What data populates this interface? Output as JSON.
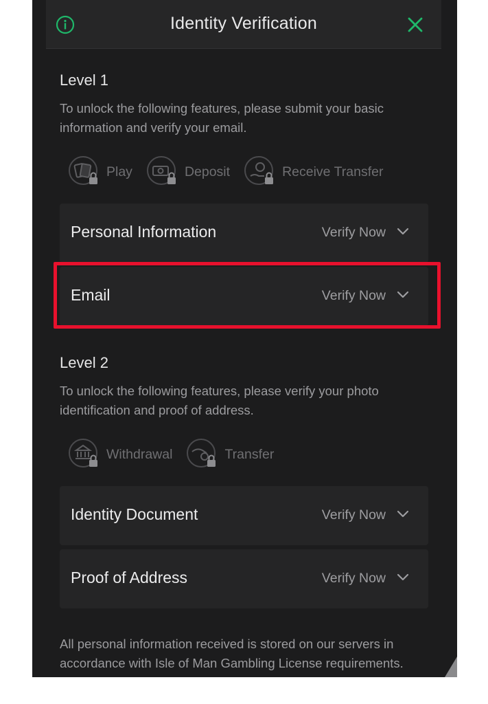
{
  "header": {
    "title": "Identity Verification"
  },
  "level1": {
    "title": "Level 1",
    "description": "To unlock the following features, please submit your basic information and verify your email.",
    "features": [
      {
        "label": "Play",
        "icon": "cards-icon"
      },
      {
        "label": "Deposit",
        "icon": "money-icon"
      },
      {
        "label": "Receive Transfer",
        "icon": "coin-hand-icon"
      }
    ],
    "items": [
      {
        "label": "Personal Information",
        "action": "Verify Now"
      },
      {
        "label": "Email",
        "action": "Verify Now"
      }
    ]
  },
  "level2": {
    "title": "Level 2",
    "description": "To unlock the following features, please verify your photo identification and proof of address.",
    "features": [
      {
        "label": "Withdrawal",
        "icon": "bank-icon"
      },
      {
        "label": "Transfer",
        "icon": "hand-coin-icon"
      }
    ],
    "items": [
      {
        "label": "Identity Document",
        "action": "Verify Now"
      },
      {
        "label": "Proof of Address",
        "action": "Verify Now"
      }
    ]
  },
  "footer": {
    "note": "All personal information received is stored on our servers in accordance with Isle of Man Gambling License requirements."
  },
  "colors": {
    "accent": "#1fb86a",
    "highlight": "#e8112d",
    "background": "#1c1c1d",
    "card": "#252526"
  }
}
